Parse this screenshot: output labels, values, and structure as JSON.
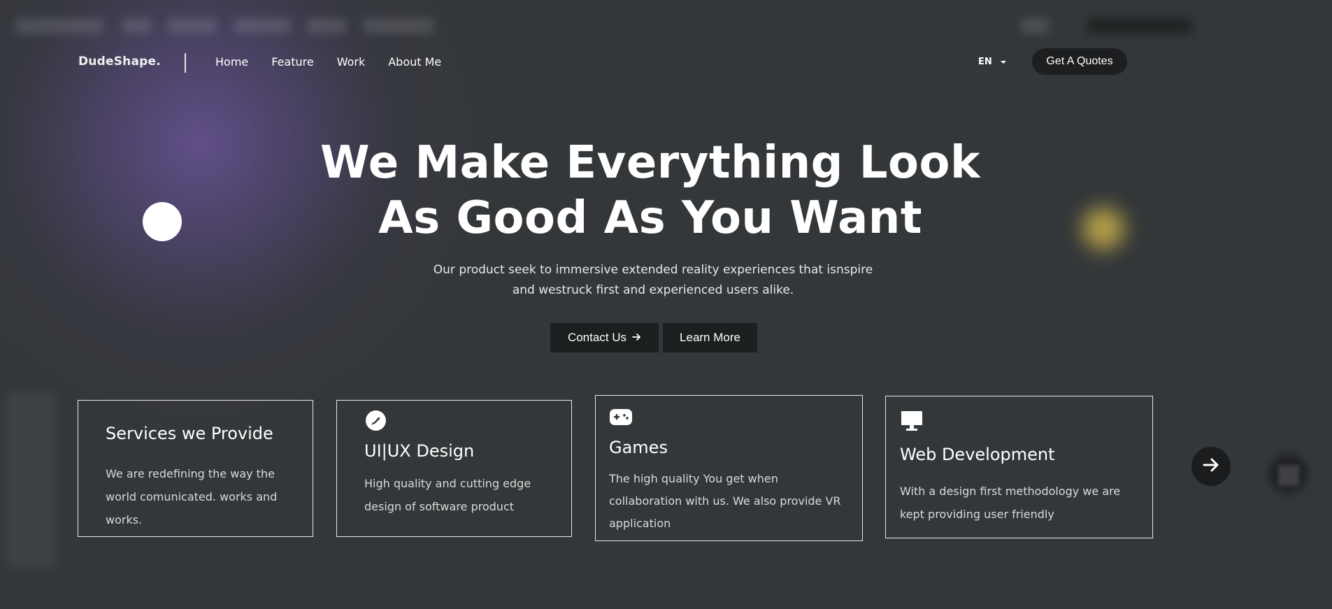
{
  "nav": {
    "logo": "DudeShape.",
    "links": [
      "Home",
      "Feature",
      "Work",
      "About Me"
    ],
    "language": "EN",
    "cta_label": "Get A Quotes"
  },
  "hero": {
    "title_line1": "We Make Everything Look",
    "title_line2": "As Good As You Want",
    "subtitle_line1": "Our product seek to immersive extended reality experiences that isnspire",
    "subtitle_line2": "and westruck first and experienced users alike.",
    "contact_label": "Contact Us",
    "learn_label": "Learn More"
  },
  "cards": [
    {
      "title": "Services we Provide",
      "desc": [
        "We are redefining the way the",
        "world comunicated. works and",
        "works."
      ]
    },
    {
      "icon": "brush-icon",
      "title": "UI|UX Design",
      "desc": [
        "High quality and cutting edge",
        "design of software product"
      ]
    },
    {
      "icon": "gamepad-icon",
      "title": "Games",
      "desc": [
        "The high quality You get when",
        "collaboration with us. We also provide VR",
        "application"
      ]
    },
    {
      "icon": "monitor-icon",
      "title": "Web Development",
      "desc": [
        "With a design first methodology we are",
        "kept providing user friendly"
      ]
    }
  ],
  "icons": {
    "contact_arrow": "arrow-right-icon",
    "next": "arrow-right-circle-icon",
    "language_caret": "caret-down-icon"
  },
  "colors": {
    "background": "#343739",
    "button_dark": "#1c1f20",
    "glow_purple": "#62508c",
    "glow_yellow": "#c8b04a",
    "card_border": "#e8e8e8"
  }
}
